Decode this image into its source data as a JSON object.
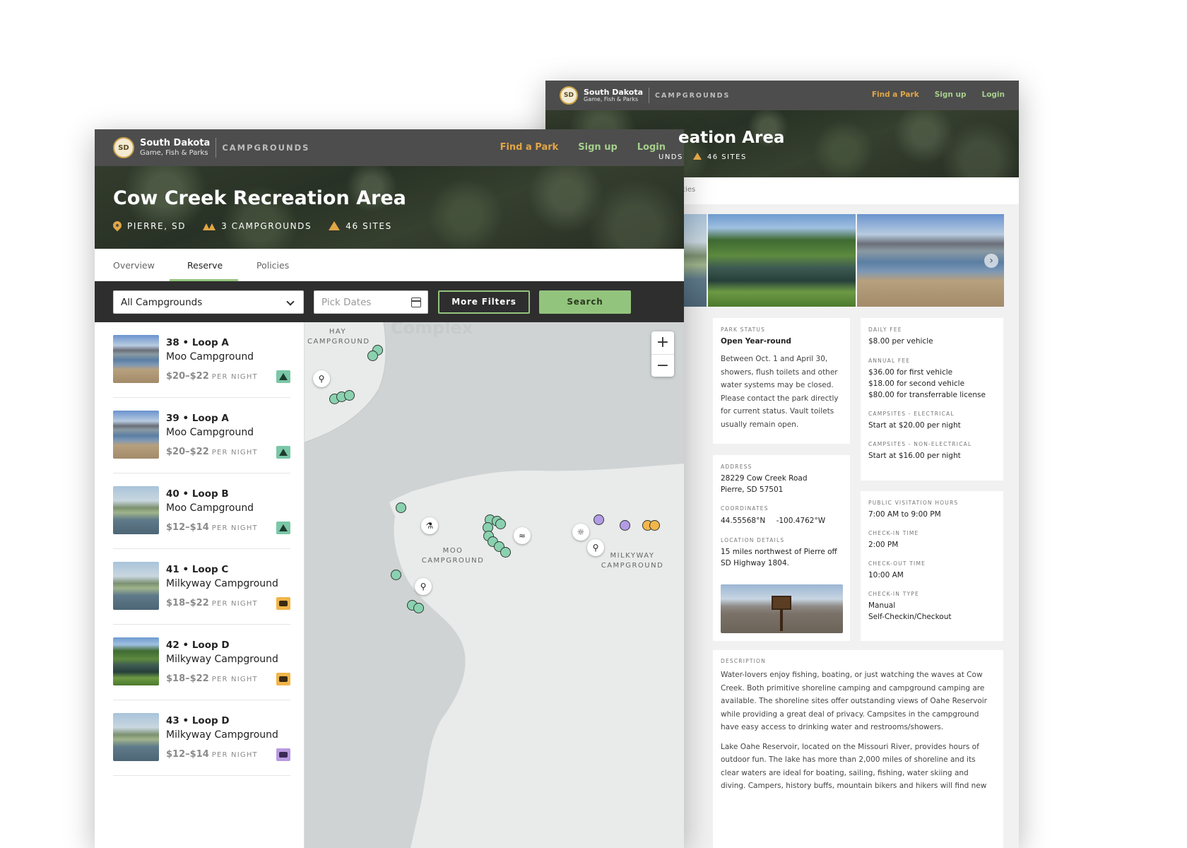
{
  "brand": {
    "name": "South Dakota",
    "sub": "Game, Fish & Parks",
    "section": "CAMPGROUNDS",
    "badge": "SD"
  },
  "nav": {
    "find": "Find a Park",
    "signup": "Sign up",
    "login": "Login"
  },
  "park": {
    "title": "Cow Creek Recreation Area",
    "back_title_partial": "eation Area",
    "location": "PIERRE, SD",
    "campgrounds": "3 CAMPGROUNDS",
    "sites": "46 SITES",
    "back_campgrounds_partial": "UNDS"
  },
  "tabs": [
    {
      "label": "Overview"
    },
    {
      "label": "Reserve"
    },
    {
      "label": "Policies"
    }
  ],
  "back_tab_partial": "licies",
  "filters": {
    "campground": "All Campgrounds",
    "dates_placeholder": "Pick Dates",
    "more": "More Filters",
    "search": "Search"
  },
  "sites": [
    {
      "title": "38 • Loop A",
      "campground": "Moo Campground",
      "price": "$20–$22",
      "per": "PER NIGHT",
      "type": "tent"
    },
    {
      "title": "39 • Loop A",
      "campground": "Moo Campground",
      "price": "$20–$22",
      "per": "PER NIGHT",
      "type": "tent"
    },
    {
      "title": "40 • Loop B",
      "campground": "Moo Campground",
      "price": "$12–$14",
      "per": "PER NIGHT",
      "type": "tent"
    },
    {
      "title": "41 • Loop C",
      "campground": "Milkyway Campground",
      "price": "$18–$22",
      "per": "PER NIGHT",
      "type": "rv"
    },
    {
      "title": "42 • Loop D",
      "campground": "Milkyway Campground",
      "price": "$18–$22",
      "per": "PER NIGHT",
      "type": "rv"
    },
    {
      "title": "43 • Loop D",
      "campground": "Milkyway Campground",
      "price": "$12–$14",
      "per": "PER NIGHT",
      "type": "rv-purple"
    }
  ],
  "map": {
    "complex": "Complex",
    "hay": [
      "HAY",
      "CAMPGROUND"
    ],
    "moo": [
      "MOO",
      "CAMPGROUND"
    ],
    "milkyway": [
      "MILKYWAY",
      "CAMPGROUND"
    ],
    "zoom_in": "+",
    "zoom_out": "−"
  },
  "info": {
    "status_label": "PARK STATUS",
    "status_value": "Open Year-round",
    "status_note": "Between Oct. 1 and April 30, showers, flush toilets and other water systems may be closed. Please contact the park directly for current status. Vault toilets usually remain open.",
    "daily_label": "DAILY FEE",
    "daily_value": "$8.00 per vehicle",
    "annual_label": "ANNUAL FEE",
    "annual_1": "$36.00 for first vehicle",
    "annual_2": "$18.00 for second vehicle",
    "annual_3": "$80.00 for transferrable license",
    "elec_label": "CAMPSITES - ELECTRICAL",
    "elec_value": "Start at $20.00 per night",
    "nonelec_label": "CAMPSITES - NON-ELECTRICAL",
    "nonelec_value": "Start at $16.00 per night",
    "address_label": "ADDRESS",
    "address_1": "28229 Cow Creek Road",
    "address_2": "Pierre, SD 57501",
    "coords_label": "COORDINATES",
    "lat": "44.55568°N",
    "lon": "-100.4762°W",
    "locdet_label": "LOCATION DETAILS",
    "locdet_value": "15 miles northwest of Pierre off SD Highway 1804.",
    "hours_label": "PUBLIC VISITATION HOURS",
    "hours_value": "7:00 AM to 9:00 PM",
    "checkin_label": "CHECK-IN TIME",
    "checkin_value": "2:00 PM",
    "checkout_label": "CHECK-OUT TIME",
    "checkout_value": "10:00 AM",
    "checkintype_label": "CHECK-IN TYPE",
    "checkintype_1": "Manual",
    "checkintype_2": "Self-Checkin/Checkout",
    "desc_label": "DESCRIPTION",
    "desc_1": "Water-lovers enjoy fishing, boating, or just watching the waves at Cow Creek. Both primitive shoreline camping and campground camping are available. The shoreline sites offer outstanding views of Oahe Reservoir while providing a great deal of privacy. Campsites in the campground have easy access to drinking water and restrooms/showers.",
    "desc_2": "Lake Oahe Reservoir, located on the Missouri River, provides hours of outdoor fun. The lake has more than 2,000 miles of shoreline and its clear waters are ideal for boating, sailing, fishing, water skiing and diving. Campers, history buffs, mountain bikers and hikers will find new"
  },
  "colors": {
    "nav": "#4d4d4d",
    "accent_orange": "#e2a646",
    "accent_green": "#93c47d",
    "site_green": "#8ad1b0",
    "site_purple": "#b49be6"
  }
}
